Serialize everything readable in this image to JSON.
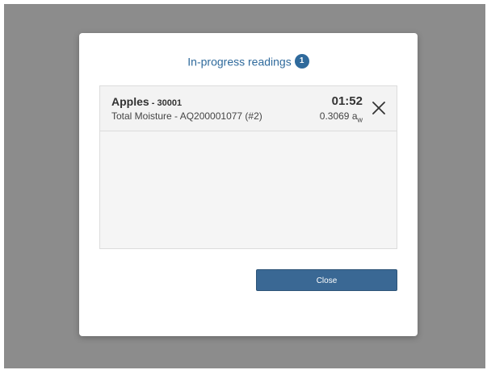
{
  "dialog": {
    "title": "In-progress readings",
    "count": "1",
    "close_label": "Close"
  },
  "readings": [
    {
      "sample_name": "Apples",
      "separator": " - ",
      "sample_id": "30001",
      "test": "Total Moisture - AQ200001077 (#2)",
      "timer": "01:52",
      "aw_value": "0.3069 a",
      "aw_subscript": "w"
    }
  ],
  "icons": {
    "remove": "close-icon"
  },
  "colors": {
    "accent": "#2f6a9c",
    "button": "#3a6894",
    "overlay": "#8c8c8c"
  }
}
